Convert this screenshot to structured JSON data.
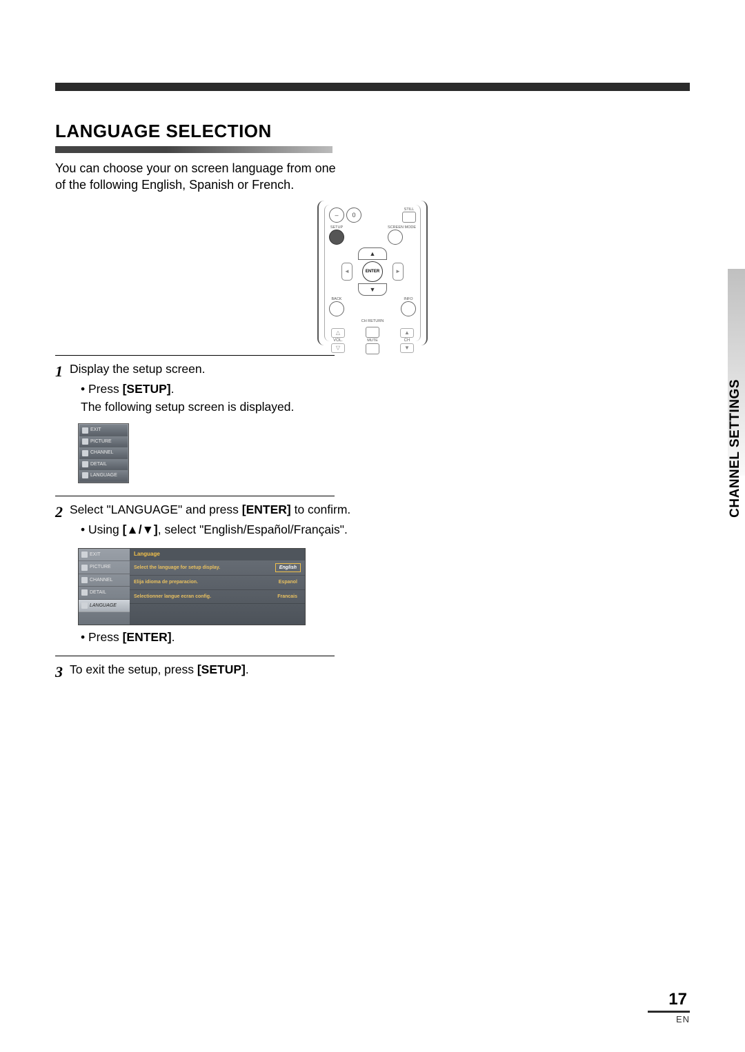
{
  "heading": "LANGUAGE SELECTION",
  "intro": "You can choose your on screen language from one of the following English, Spanish or French.",
  "remote": {
    "still": "STILL",
    "zero": "0",
    "setup": "SETUP",
    "screen_mode": "SCREEN MODE",
    "enter": "ENTER",
    "back": "BACK",
    "info": "INFO",
    "ch_return": "CH RETURN",
    "vol": "VOL.",
    "mute": "MUTE",
    "ch": "CH"
  },
  "steps": {
    "s1": {
      "num": "1",
      "text": "Display the setup screen.",
      "bullet_prefix": "• Press ",
      "bullet_btn": "[SETUP]",
      "bullet_suffix": ".",
      "sub": "The following setup screen is displayed."
    },
    "s2": {
      "num": "2",
      "text_a": "Select \"LANGUAGE\" and press ",
      "text_btn": "[ENTER]",
      "text_b": " to confirm.",
      "bullet_a": "• Using ",
      "bullet_keys": "[▲/▼]",
      "bullet_b": ", select \"English/Español/Français\".",
      "bullet2_prefix": "• Press ",
      "bullet2_btn": "[ENTER]",
      "bullet2_suffix": "."
    },
    "s3": {
      "num": "3",
      "text_a": "To exit the setup, press ",
      "text_btn": "[SETUP]",
      "text_b": "."
    }
  },
  "menu": {
    "items": [
      "EXIT",
      "PICTURE",
      "CHANNEL",
      "DETAIL",
      "LANGUAGE"
    ]
  },
  "lang_screen": {
    "title": "Language",
    "rows": [
      {
        "left": "Select the language for setup display.",
        "right": "English",
        "selected": true
      },
      {
        "left": "Elija idioma de preparacion.",
        "right": "Espanol",
        "selected": false
      },
      {
        "left": "Selectionner langue ecran config.",
        "right": "Francais",
        "selected": false
      }
    ]
  },
  "side": "CHANNEL SETTINGS",
  "page_number": "17",
  "page_lang": "EN"
}
